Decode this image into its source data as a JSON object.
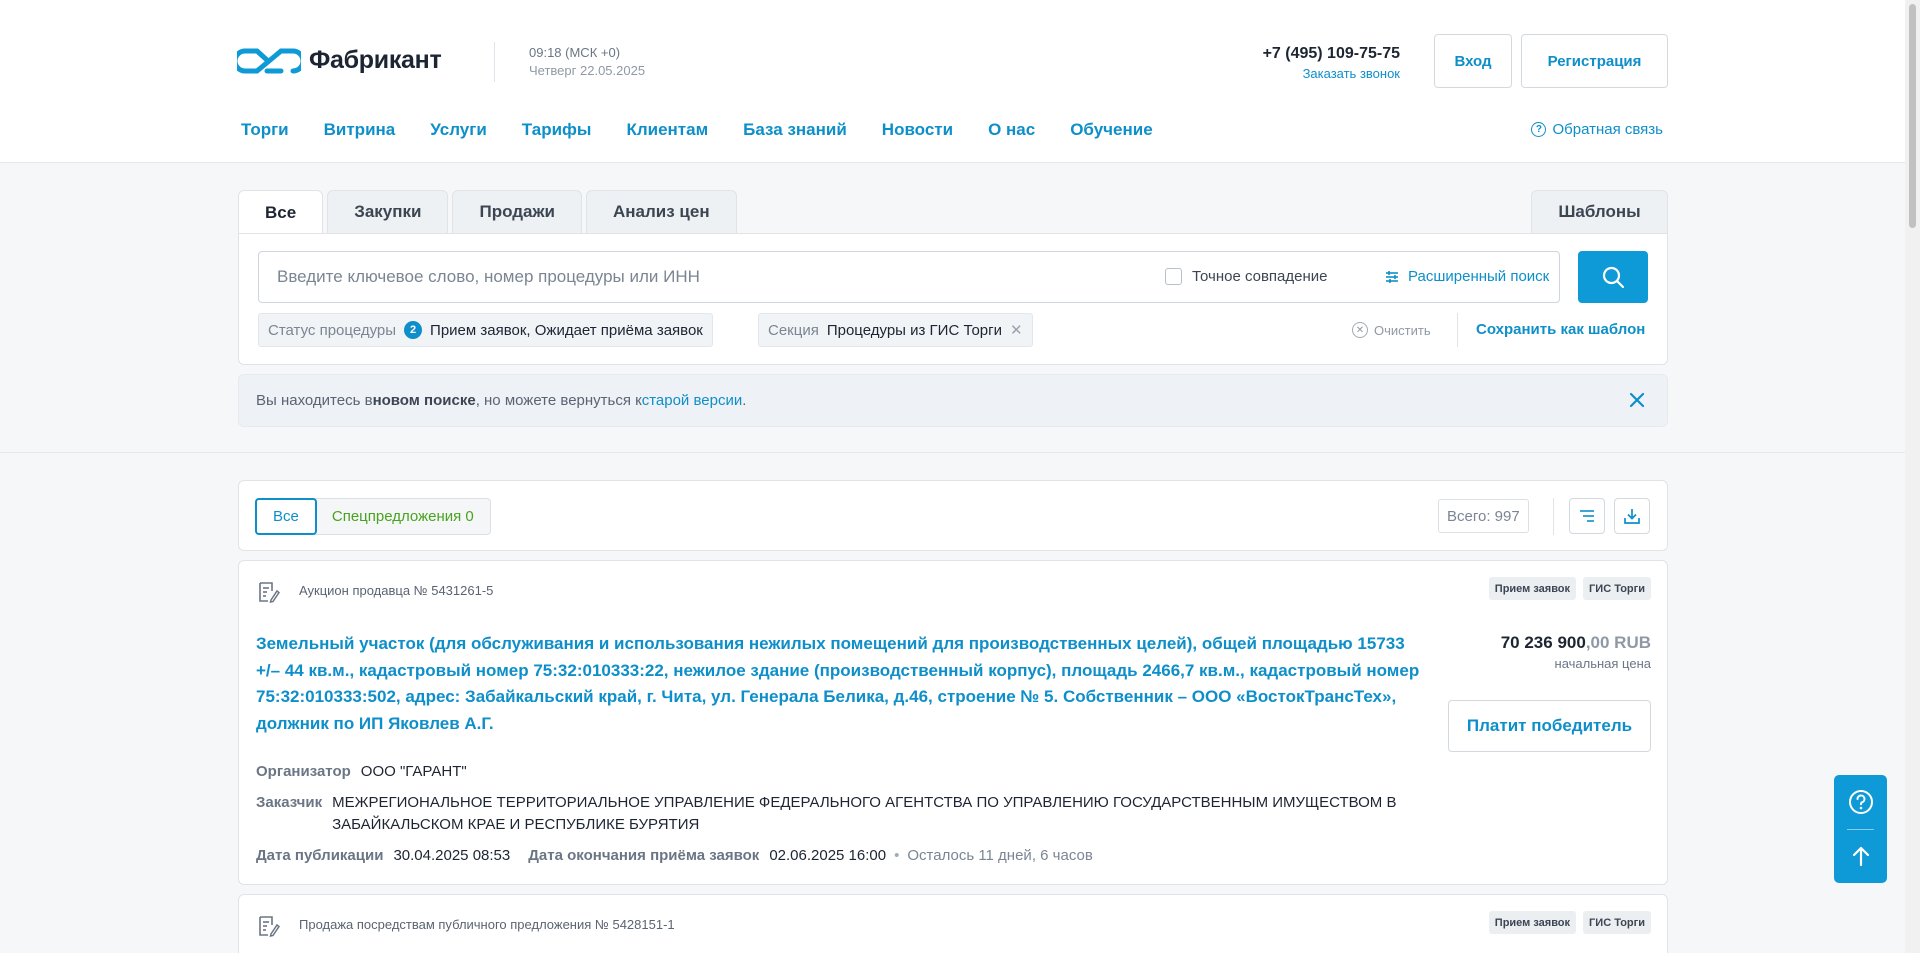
{
  "header": {
    "logo_text": "Фабрикант",
    "time": "09:18 (МСК +0)",
    "day": "Четверг 22.05.2025",
    "phone": "+7 (495) 109-75-75",
    "callback": "Заказать звонок",
    "login": "Вход",
    "register": "Регистрация",
    "feedback": "Обратная связь"
  },
  "nav": [
    "Торги",
    "Витрина",
    "Услуги",
    "Тарифы",
    "Клиентам",
    "База знаний",
    "Новости",
    "О нас",
    "Обучение"
  ],
  "search": {
    "tabs": [
      "Все",
      "Закупки",
      "Продажи",
      "Анализ цен"
    ],
    "templates_tab": "Шаблоны",
    "placeholder": "Введите ключевое слово, номер процедуры или ИНН",
    "exact_match": "Точное совпадение",
    "advanced": "Расширенный поиск",
    "filters": [
      {
        "label": "Статус процедуры",
        "count": "2",
        "value": "Прием заявок, Ожидает приёма заявок"
      },
      {
        "label": "Секция",
        "value": "Процедуры из ГИС Торги"
      }
    ],
    "clear": "Очистить",
    "save_template": "Сохранить как шаблон"
  },
  "notice": {
    "part1": "Вы находитесь в ",
    "bold": "новом поиске",
    "part2": ", но можете вернуться к ",
    "link": "старой версии",
    "part3": "."
  },
  "results": {
    "seg_all": "Все",
    "seg_special": "Спецпредложения 0",
    "total": "Всего: 997"
  },
  "lots": [
    {
      "type": "Аукцион продавца № 5431261-5",
      "badges": [
        "Прием заявок",
        "ГИС Торги"
      ],
      "title": "Земельный участок (для обслуживания и использования нежилых помещений для производственных целей), общей площадью 15733 +/– 44 кв.м., кадастровый номер 75:32:010333:22, нежилое здание (производственный корпус), площадь 2466,7 кв.м., кадастровый номер 75:32:010333:502, адрес: Забайкальский край, г. Чита, ул. Генерала Белика, д.46, строение № 5. Собственник – ООО «ВостокТрансТех», должник по ИП Яковлев А.Г.",
      "price_int": "70 236 900",
      "price_dec": ",00 RUB",
      "price_label": "начальная цена",
      "pay_button": "Платит победитель",
      "organizer_label": "Организатор",
      "organizer": "ООО \"ГАРАНТ\"",
      "customer_label": "Заказчик",
      "customer": "МЕЖРЕГИОНАЛЬНОЕ ТЕРРИТОРИАЛЬНОЕ УПРАВЛЕНИЕ ФЕДЕРАЛЬНОГО АГЕНТСТВА ПО УПРАВЛЕНИЮ ГОСУДАРСТВЕННЫМ ИМУЩЕСТВОМ В ЗАБАЙКАЛЬСКОМ КРАЕ И РЕСПУБЛИКЕ БУРЯТИЯ",
      "pub_label": "Дата публикации",
      "pub_date": "30.04.2025 08:53",
      "end_label": "Дата окончания приёма заявок",
      "end_date": "02.06.2025 16:00",
      "remaining": "Осталось 11 дней, 6 часов"
    },
    {
      "type": "Продажа посредствам публичного предложения № 5428151-1",
      "badges": [
        "Прием заявок",
        "ГИС Торги"
      ]
    }
  ],
  "icons": {
    "logo": "infinity-logo-icon",
    "search": "search-icon",
    "filter": "sliders-icon",
    "sort": "sort-lines-icon",
    "download": "download-icon",
    "document": "document-pen-icon",
    "help": "question-circle-icon",
    "up": "arrow-up-icon",
    "close": "close-icon"
  },
  "colors": {
    "accent": "#0e8fc9",
    "button": "#0e9ad6",
    "green": "#4aa31f"
  }
}
